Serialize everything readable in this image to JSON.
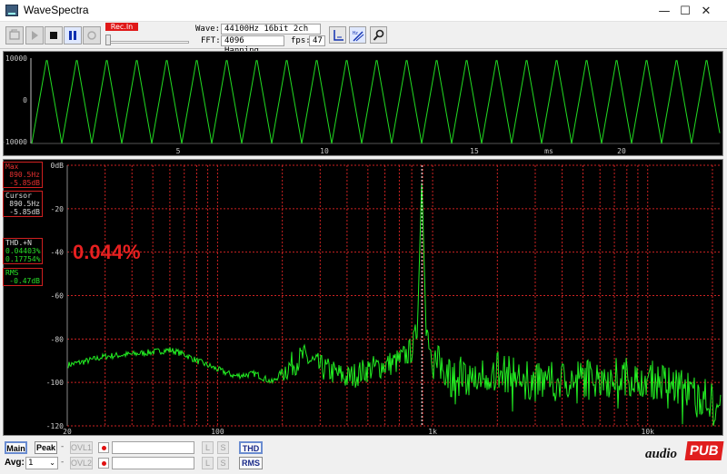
{
  "window": {
    "title": "WaveSpectra",
    "minimize": "—",
    "maximize": "☐",
    "close": "✕"
  },
  "toolbar": {
    "rec_label": "Rec.In",
    "wave_label": "Wave:",
    "wave_value": "44100Hz 16bit 2ch",
    "fft_label": "FFT:",
    "fft_value": "4096 Hanning",
    "fps_label": "fps:",
    "fps_value": "47",
    "icons": [
      "cd-open-icon",
      "play-icon",
      "stop-icon",
      "pause-icon",
      "record-icon",
      "scale-icon",
      "hz-scale-icon",
      "settings-icon"
    ]
  },
  "waveform": {
    "y_ticks": [
      "10000",
      "0",
      "-10000"
    ],
    "x_ticks": [
      "5",
      "10",
      "15",
      "20"
    ],
    "x_unit": "ms",
    "trace_color": "#22dd22"
  },
  "spectrum": {
    "y_ticks": [
      "0dB",
      "-20",
      "-40",
      "-60",
      "-80",
      "-100",
      "-120"
    ],
    "x_ticks": [
      "20",
      "100",
      "1k",
      "10k"
    ],
    "trace_color": "#22ee22",
    "grid_color": "#cc2222",
    "thd_big": "0.044%",
    "readouts": {
      "max_label": "Max",
      "max_freq": "890.5Hz",
      "max_db": "-5.85dB",
      "cursor_label": "Cursor",
      "cursor_freq": "890.5Hz",
      "cursor_db": "-5.85dB",
      "thd_label": "THD.+N",
      "thd_val1": "0.04403%",
      "thd_val2": "0.17754%",
      "rms_label": "RMS",
      "rms_val": "-0.47dB"
    }
  },
  "chart_data": {
    "type": "line",
    "title": "",
    "xlabel": "",
    "ylabel": "",
    "x_scale": "log",
    "xlim": [
      20,
      22050
    ],
    "ylim": [
      -120,
      0
    ],
    "peak": {
      "freq_hz": 890.5,
      "level_db": -5.85
    },
    "series": [
      {
        "x": [
          20,
          25,
          30,
          40,
          50,
          60,
          70,
          80,
          100,
          120,
          150,
          180,
          200,
          250,
          300,
          400,
          500,
          600,
          700,
          800,
          850,
          890.5,
          930,
          1000,
          1200,
          1500,
          2000,
          3000,
          5000,
          8000,
          10000,
          15000,
          20000,
          22050
        ],
        "y": [
          -92,
          -90,
          -88,
          -87,
          -86,
          -85,
          -87,
          -90,
          -94,
          -97,
          -96,
          -100,
          -95,
          -88,
          -93,
          -98,
          -94,
          -92,
          -90,
          -85,
          -75,
          -6,
          -72,
          -90,
          -95,
          -98,
          -95,
          -100,
          -98,
          -97,
          -98,
          -103,
          -108,
          -112
        ]
      }
    ]
  },
  "bottom": {
    "main": "Main",
    "peak": "Peak",
    "ovl1": "OVL1",
    "ovl2": "OVL2",
    "avg_label": "Avg:",
    "avg_value": "1",
    "l": "L",
    "s": "S",
    "thd": "THD",
    "rms": "RMS",
    "logo_audio": "audio",
    "logo_pub": "PUB"
  }
}
